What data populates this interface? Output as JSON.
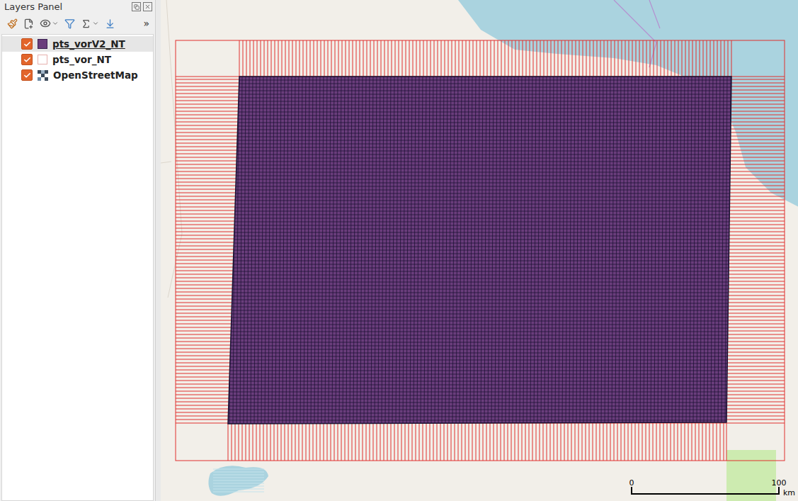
{
  "layers_panel": {
    "title": "Layers Panel",
    "overflow": "»",
    "layers": [
      {
        "name": "pts_vorV2_NT",
        "checked": true,
        "selected": true,
        "kind": "fill",
        "color": "#6a3d7c"
      },
      {
        "name": "pts_vor_NT",
        "checked": true,
        "selected": false,
        "kind": "outline",
        "color": "#e0312e"
      },
      {
        "name": "OpenStreetMap",
        "checked": true,
        "selected": false,
        "kind": "raster"
      }
    ]
  },
  "map": {
    "scale_bar": {
      "labels": [
        "0",
        "100"
      ],
      "unit": "km"
    }
  }
}
